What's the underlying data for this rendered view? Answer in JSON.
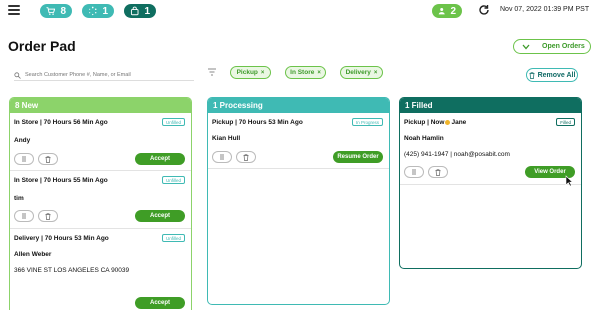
{
  "header": {
    "cart_count": "8",
    "spin_count": "1",
    "bag_count": "1",
    "user_count": "2",
    "datetime": "Nov 07, 2022 01:39 PM PST"
  },
  "page": {
    "title": "Order Pad",
    "open_orders_label": "Open Orders"
  },
  "search": {
    "placeholder": "Search Customer Phone #, Name, or Email"
  },
  "filters": {
    "chips": [
      "Pickup",
      "In Store",
      "Delivery"
    ],
    "chip_remove": "×",
    "remove_all_label": "Remove All"
  },
  "columns": {
    "new": {
      "title": "8 New",
      "cards": [
        {
          "title": "In Store | 70 Hours 56 Min Ago",
          "badge": "Unfilled",
          "customer": "Andy",
          "action": "Accept"
        },
        {
          "title": "In Store | 70 Hours 55 Min Ago",
          "badge": "Unfilled",
          "customer": "tim",
          "action": "Accept"
        },
        {
          "title": "Delivery | 70 Hours 53 Min Ago",
          "badge": "Unfilled",
          "customer": "Allen Weber",
          "address": "366 VINE ST  LOS ANGELES CA 90039",
          "action": "Accept"
        }
      ]
    },
    "processing": {
      "title": "1 Processing",
      "cards": [
        {
          "title": "Pickup | 70 Hours 53 Min Ago",
          "badge": "In Progress",
          "customer": "Kian Hull",
          "action": "Resume Order"
        }
      ]
    },
    "filled": {
      "title": "1 Filled",
      "cards": [
        {
          "title_prefix": "Pickup | Now",
          "title_suffix": "Jane",
          "badge": "Filled",
          "customer": "Noah Hamlin",
          "contact": "(425) 941-1947 | noah@posabit.com",
          "action": "View Order"
        }
      ]
    }
  },
  "colors": {
    "green": "#6cc34a",
    "teal": "#3fbab4",
    "dark_teal": "#0f6e60",
    "button_green": "#3f9d26"
  }
}
